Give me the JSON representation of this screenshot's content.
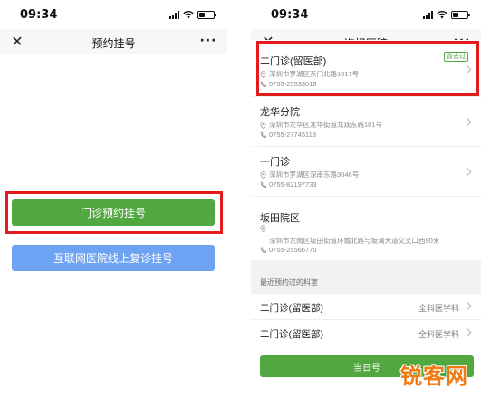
{
  "left_screen": {
    "status": {
      "time": "09:34"
    },
    "nav": {
      "close_icon": "close-icon",
      "title": "预约挂号",
      "more_icon": "more-icon"
    },
    "buttons": {
      "clinic_booking": "门诊预约挂号",
      "online_revisit": "互联网医院线上复诊挂号"
    },
    "colors": {
      "primary_green": "#52a840",
      "secondary_blue": "#6ea3f3",
      "highlight_red": "#e31b1b"
    }
  },
  "right_screen": {
    "status": {
      "time": "09:34"
    },
    "nav": {
      "close_icon": "close-icon",
      "title": "选择医院",
      "more_icon": "more-icon"
    },
    "hospitals": [
      {
        "name": "二门诊(留医部)",
        "address": "深圳市罗湖区东门北路1017号",
        "phone": "0755-25533018",
        "badge": "曾去过"
      },
      {
        "name": "龙华分院",
        "address": "深圳市龙华区龙华街道龙观东路101号",
        "phone": "0755-27745118"
      },
      {
        "name": "一门诊",
        "address": "深圳市罗湖区深南东路3046号",
        "phone": "0755-82197733"
      },
      {
        "name": "坂田院区",
        "address": "深圳市龙岗区坂田街道环城北路与坂澜大道交叉口西90米",
        "phone": "0755-25566770"
      }
    ],
    "recent": {
      "title": "最近预约过的科室",
      "items": [
        {
          "name": "二门诊(留医部)",
          "dept": "全科医学科"
        },
        {
          "name": "二门诊(留医部)",
          "dept": "全科医学科"
        }
      ]
    },
    "bottom_button": "当日号",
    "icons": {
      "location": "location-pin-icon",
      "phone": "phone-icon",
      "chevron": "chevron-right-icon"
    }
  },
  "watermark": "锐客网"
}
